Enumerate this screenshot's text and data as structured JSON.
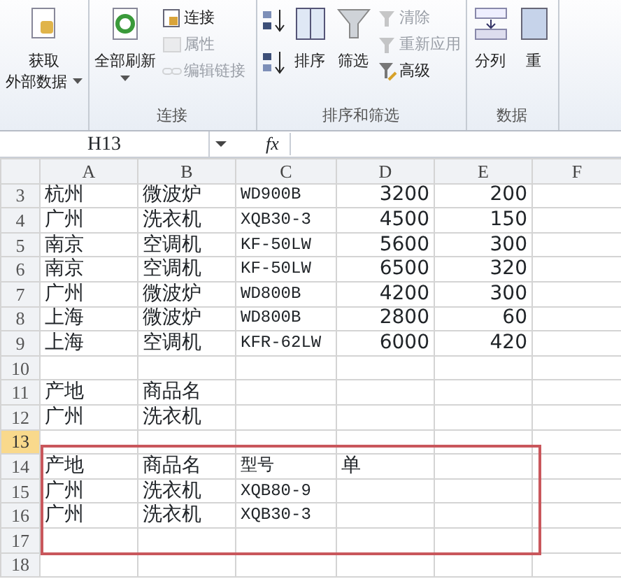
{
  "ribbon": {
    "groups": [
      {
        "buttons": [
          {
            "kind": "large",
            "lines": [
              "获取",
              "外部数据"
            ],
            "caret": true,
            "disabled": false
          }
        ]
      },
      {
        "label": "连接",
        "buttons": [
          {
            "kind": "large",
            "lines": [
              "全部刷新"
            ],
            "caret": true,
            "disabled": false
          },
          {
            "kind": "small",
            "lines": [
              "连接"
            ],
            "disabled": false
          },
          {
            "kind": "small",
            "lines": [
              "属性"
            ],
            "disabled": true
          },
          {
            "kind": "small",
            "lines": [
              "编辑链接"
            ],
            "disabled": true
          }
        ]
      },
      {
        "label": "排序和筛选",
        "buttons": [
          {
            "kind": "tiny"
          },
          {
            "kind": "tiny"
          },
          {
            "kind": "large",
            "lines": [
              "排序"
            ],
            "disabled": false
          },
          {
            "kind": "large",
            "lines": [
              "筛选"
            ],
            "disabled": false
          },
          {
            "kind": "small",
            "lines": [
              "清除"
            ],
            "disabled": true
          },
          {
            "kind": "small",
            "lines": [
              "重新应用"
            ],
            "disabled": true
          },
          {
            "kind": "small",
            "lines": [
              "高级"
            ],
            "disabled": false
          }
        ]
      },
      {
        "label": "数据",
        "buttons": [
          {
            "kind": "large",
            "lines": [
              "分列"
            ],
            "disabled": false
          },
          {
            "kind": "large",
            "lines": [
              "重"
            ],
            "disabled": false
          }
        ]
      }
    ]
  },
  "name_box": "H13",
  "formula_label": "fx",
  "columns": [
    "A",
    "B",
    "C",
    "D",
    "E",
    "F"
  ],
  "rows": [
    {
      "number": "3",
      "selected": false,
      "cells": [
        "杭州",
        "微波炉",
        "WD900B",
        "3200",
        "200",
        ""
      ]
    },
    {
      "number": "4",
      "selected": false,
      "cells": [
        "广州",
        "洗衣机",
        "XQB30-3",
        "4500",
        "150",
        ""
      ]
    },
    {
      "number": "5",
      "selected": false,
      "cells": [
        "南京",
        "空调机",
        "KF-50LW",
        "5600",
        "300",
        ""
      ]
    },
    {
      "number": "6",
      "selected": false,
      "cells": [
        "南京",
        "空调机",
        "KF-50LW",
        "6500",
        "320",
        ""
      ]
    },
    {
      "number": "7",
      "selected": false,
      "cells": [
        "广州",
        "微波炉",
        "WD800B",
        "4200",
        "300",
        ""
      ]
    },
    {
      "number": "8",
      "selected": false,
      "cells": [
        "上海",
        "微波炉",
        "WD800B",
        "2800",
        "60",
        ""
      ]
    },
    {
      "number": "9",
      "selected": false,
      "cells": [
        "上海",
        "空调机",
        "KFR-62LW",
        "6000",
        "420",
        ""
      ]
    },
    {
      "number": "10",
      "selected": false,
      "cells": [
        "",
        "",
        "",
        "",
        "",
        ""
      ]
    },
    {
      "number": "11",
      "selected": false,
      "cells": [
        "产地",
        "商品名",
        "",
        "",
        "",
        ""
      ]
    },
    {
      "number": "12",
      "selected": false,
      "cells": [
        "广州",
        "洗衣机",
        "",
        "",
        "",
        ""
      ]
    },
    {
      "number": "13",
      "selected": true,
      "cells": [
        "",
        "",
        "",
        "",
        "",
        ""
      ]
    },
    {
      "number": "14",
      "selected": false,
      "cells": [
        "产地",
        "商品名",
        "型号",
        "单",
        "",
        ""
      ]
    },
    {
      "number": "15",
      "selected": false,
      "cells": [
        "广州",
        "洗衣机",
        "XQB80-9",
        "",
        "",
        ""
      ]
    },
    {
      "number": "16",
      "selected": false,
      "cells": [
        "广州",
        "洗衣机",
        "XQB30-3",
        "",
        "",
        ""
      ]
    },
    {
      "number": "17",
      "selected": false,
      "cells": [
        "",
        "",
        "",
        "",
        "",
        ""
      ]
    },
    {
      "number": "18",
      "selected": false,
      "cells": [
        "",
        "",
        "",
        "",
        "",
        ""
      ]
    }
  ]
}
